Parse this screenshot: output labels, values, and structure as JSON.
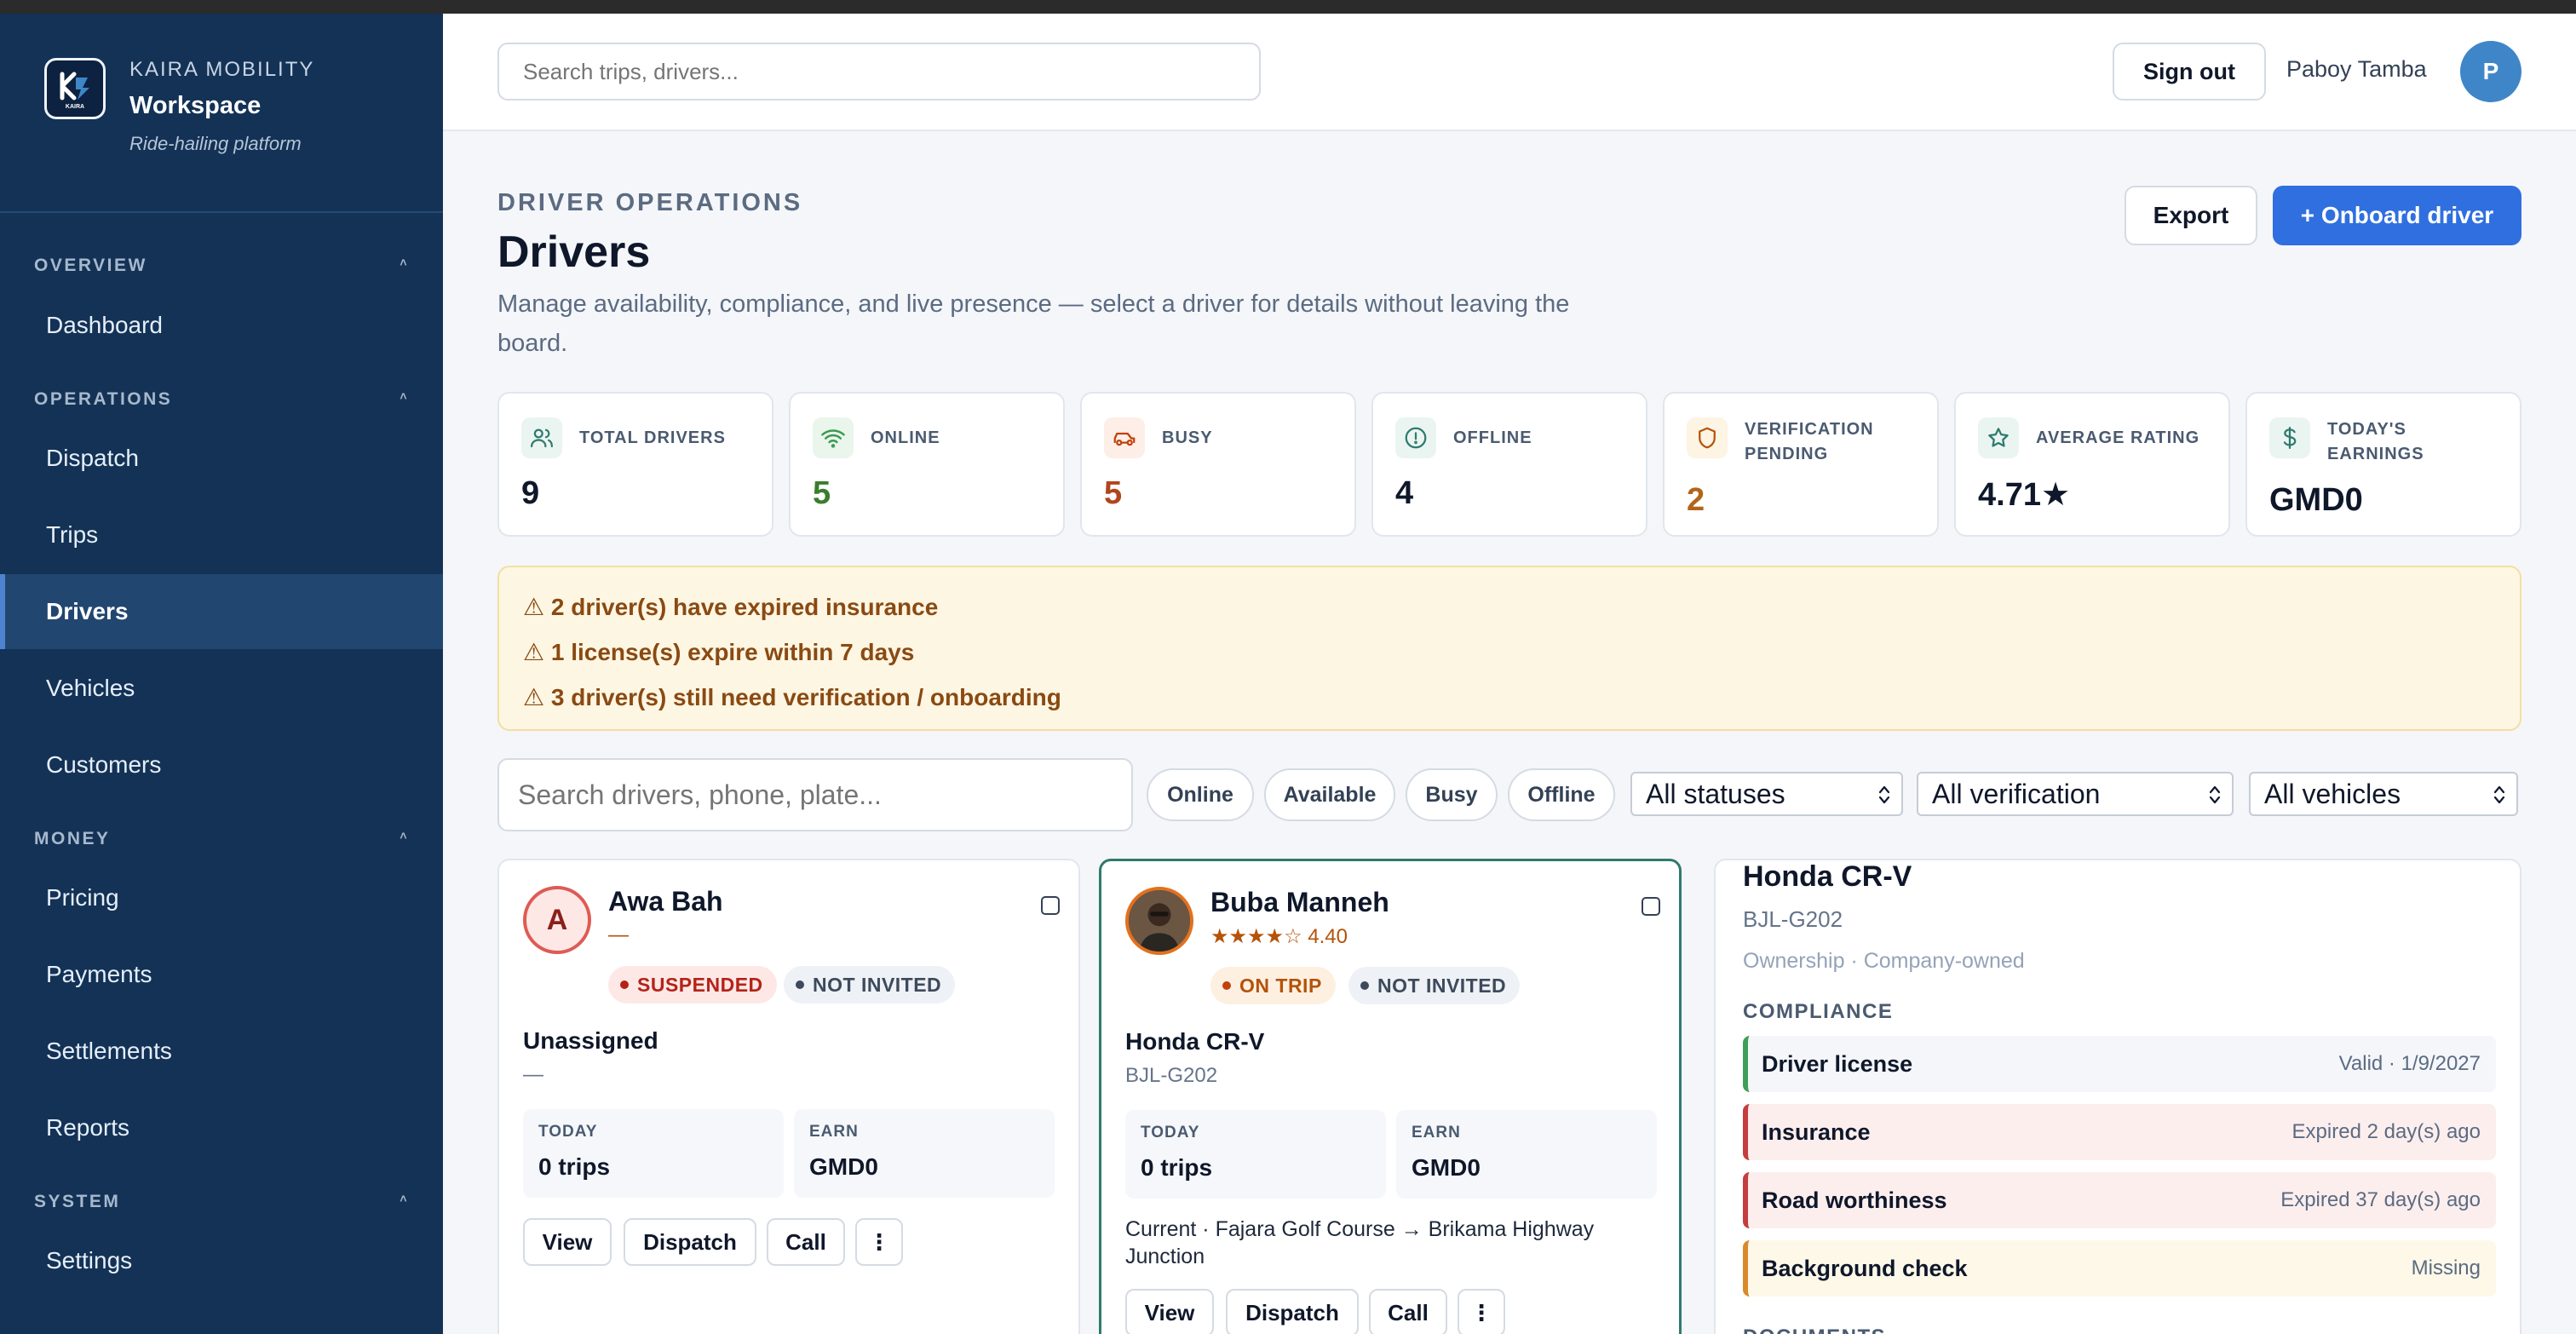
{
  "brand": {
    "org": "KAIRA MOBILITY",
    "workspace": "Workspace",
    "tagline": "Ride-hailing platform",
    "logo_text": "KAIRA"
  },
  "nav": {
    "sections": [
      {
        "label": "OVERVIEW",
        "items": [
          "Dashboard"
        ]
      },
      {
        "label": "OPERATIONS",
        "items": [
          "Dispatch",
          "Trips",
          "Drivers",
          "Vehicles",
          "Customers"
        ]
      },
      {
        "label": "MONEY",
        "items": [
          "Pricing",
          "Payments",
          "Settlements",
          "Reports"
        ]
      },
      {
        "label": "SYSTEM",
        "items": [
          "Settings"
        ]
      }
    ],
    "active": "Drivers",
    "caret": "˄"
  },
  "header": {
    "search_placeholder": "Search trips, drivers...",
    "sign_out": "Sign out",
    "user_name": "Paboy Tamba",
    "user_initial": "P"
  },
  "page": {
    "eyebrow": "DRIVER OPERATIONS",
    "title": "Drivers",
    "description": "Manage availability, compliance, and live presence — select a driver for details without leaving the board.",
    "export_label": "Export",
    "onboard_label": "+ Onboard driver"
  },
  "stats": [
    {
      "label": "TOTAL DRIVERS",
      "value": "9",
      "icon": "users-icon",
      "color": "#0f172a",
      "icon_bg": "#eaf5f1",
      "icon_color": "#2f7a6e"
    },
    {
      "label": "ONLINE",
      "value": "5",
      "icon": "wifi-icon",
      "color": "#3a7d2c",
      "icon_bg": "#eaf5ec",
      "icon_color": "#3a9b4f"
    },
    {
      "label": "BUSY",
      "value": "5",
      "icon": "car-icon",
      "color": "#b0451d",
      "icon_bg": "#fdeee8",
      "icon_color": "#c2410c"
    },
    {
      "label": "OFFLINE",
      "value": "4",
      "icon": "alert-circle-icon",
      "color": "#0f172a",
      "icon_bg": "#eaf5f1",
      "icon_color": "#2f7a6e"
    },
    {
      "label": "VERIFICATION PENDING",
      "value": "2",
      "icon": "shield-icon",
      "color": "#b3641a",
      "icon_bg": "#fdf4e3",
      "icon_color": "#b45309"
    },
    {
      "label": "AVERAGE RATING",
      "value": "4.71★",
      "icon": "star-icon",
      "color": "#0f172a",
      "icon_bg": "#eaf5f1",
      "icon_color": "#2f7a6e"
    },
    {
      "label": "TODAY'S EARNINGS",
      "value": "GMD0",
      "icon": "dollar-icon",
      "color": "#0f172a",
      "icon_bg": "#eaf5f1",
      "icon_color": "#2f7a6e"
    }
  ],
  "alerts": [
    "⚠ 2 driver(s) have expired insurance",
    "⚠ 1 license(s) expire within 7 days",
    "⚠ 3 driver(s) still need verification / onboarding"
  ],
  "filters": {
    "search_placeholder": "Search drivers, phone, plate...",
    "chips": [
      "Online",
      "Available",
      "Busy",
      "Offline"
    ],
    "selects": [
      "All statuses",
      "All verification",
      "All vehicles"
    ]
  },
  "drivers": [
    {
      "initial": "A",
      "name": "Awa Bah",
      "sub": "—",
      "status": "SUSPENDED",
      "invite": "NOT INVITED",
      "vehicle": "Unassigned",
      "plate": "—",
      "today_label": "TODAY",
      "today_value": "0 trips",
      "earn_label": "EARN",
      "earn_value": "GMD0",
      "actions": [
        "View",
        "Dispatch",
        "Call",
        "⋮"
      ]
    },
    {
      "name": "Buba Manneh",
      "stars": "★★★★☆",
      "rating": "4.40",
      "status": "ON TRIP",
      "invite": "NOT INVITED",
      "vehicle": "Honda CR-V",
      "plate": "BJL-G202",
      "today_label": "TODAY",
      "today_value": "0 trips",
      "earn_label": "EARN",
      "earn_value": "GMD0",
      "current": "Current · Fajara Golf Course → Brikama Highway Junction",
      "actions": [
        "View",
        "Dispatch",
        "Call",
        "⋮"
      ]
    }
  ],
  "detail": {
    "vehicle": "Honda CR-V",
    "plate": "BJL-G202",
    "ownership": "Ownership · Company-owned",
    "compliance_title": "COMPLIANCE",
    "compliance": [
      {
        "title": "Driver license",
        "status": "Valid · 1/9/2027"
      },
      {
        "title": "Insurance",
        "status": "Expired 2 day(s) ago"
      },
      {
        "title": "Road worthiness",
        "status": "Expired 37 day(s) ago"
      },
      {
        "title": "Background check",
        "status": "Missing"
      }
    ],
    "documents_title": "DOCUMENTS"
  }
}
